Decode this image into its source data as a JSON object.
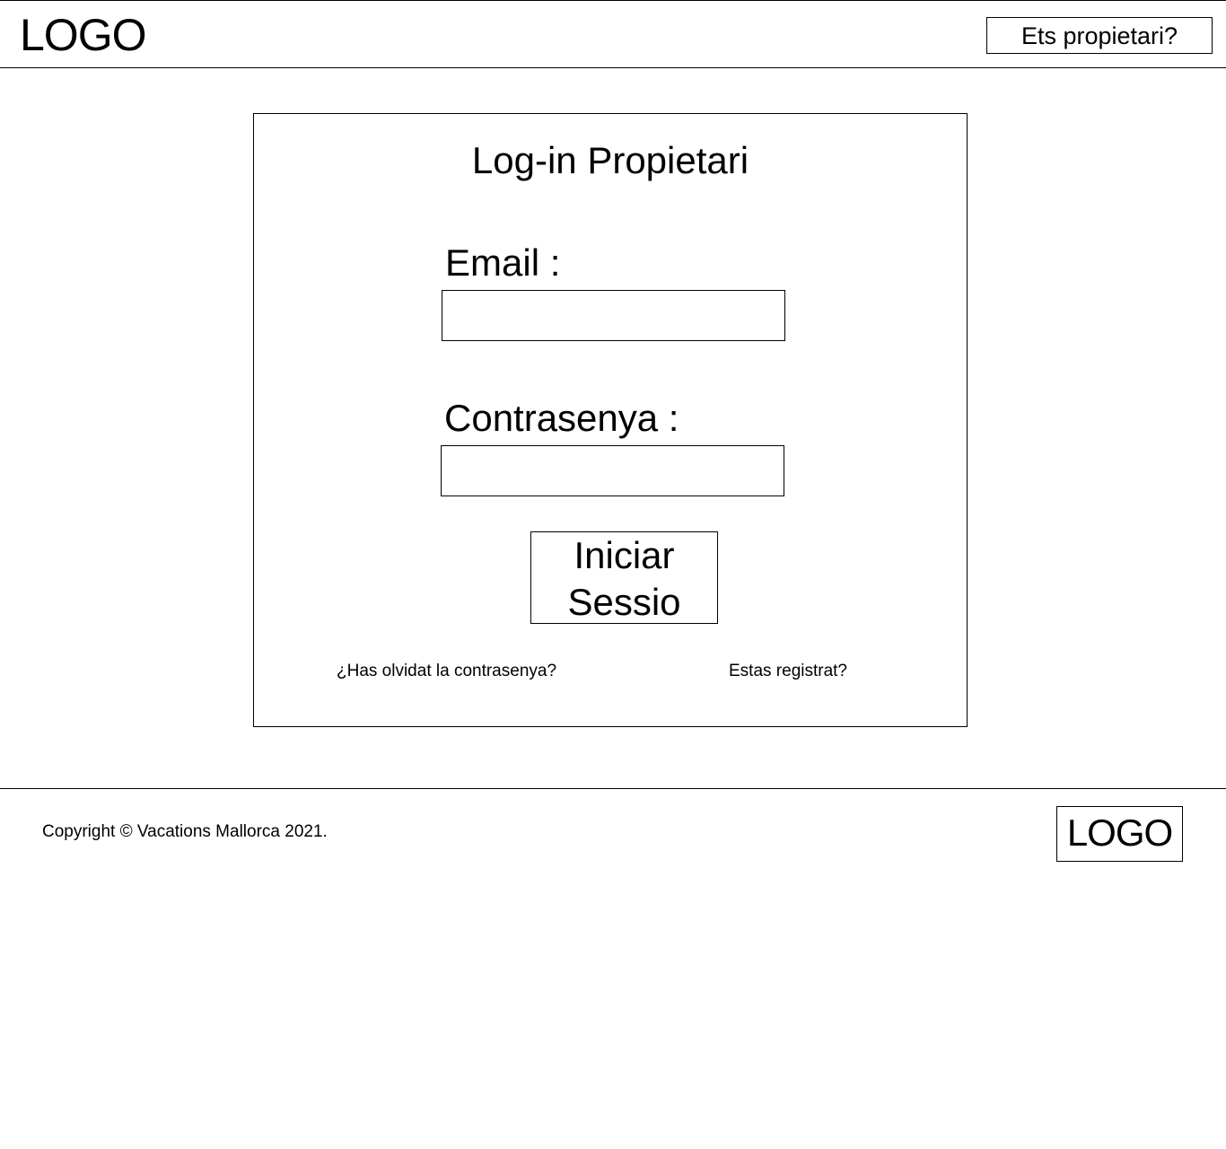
{
  "header": {
    "logo_text": "LOGO",
    "owner_button_label": "Ets propietari?"
  },
  "login": {
    "title": "Log-in Propietari",
    "email_label": "Email :",
    "email_value": "",
    "password_label": "Contrasenya :",
    "password_value": "",
    "submit_line1": "Iniciar",
    "submit_line2": "Sessio",
    "forgot_link": "¿Has olvidat la contrasenya?",
    "register_link": "Estas registrat?"
  },
  "footer": {
    "copyright": "Copyright © Vacations Mallorca 2021.",
    "logo_text": "LOGO"
  }
}
